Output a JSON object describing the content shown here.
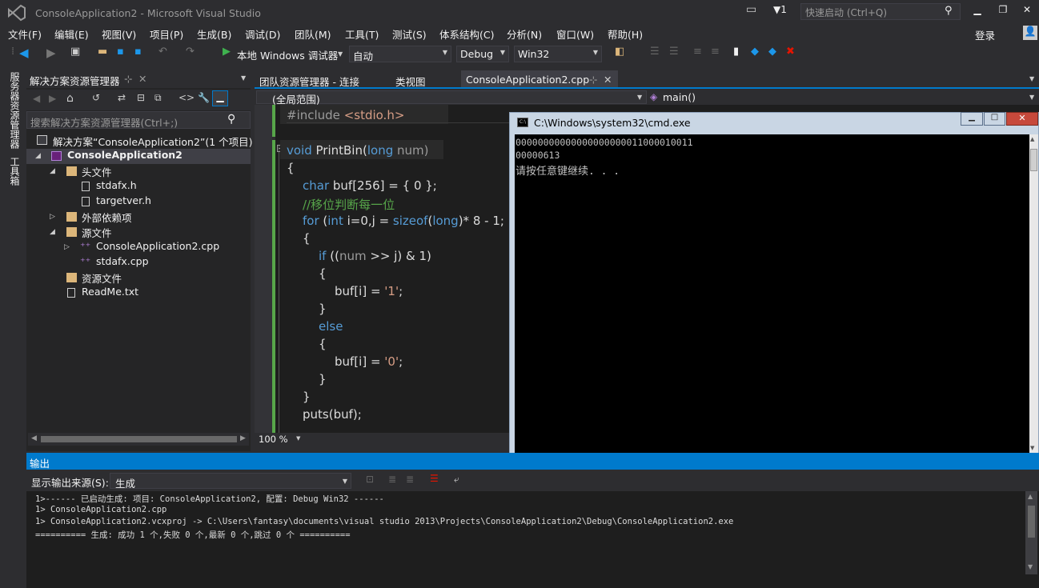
{
  "window": {
    "title": "ConsoleApplication2 - Microsoft Visual Studio",
    "quick_launch": "快速启动 (Ctrl+Q)",
    "notif_count": "1",
    "login": "登录"
  },
  "menu": [
    "文件(F)",
    "编辑(E)",
    "视图(V)",
    "项目(P)",
    "生成(B)",
    "调试(D)",
    "团队(M)",
    "工具(T)",
    "测试(S)",
    "体系结构(C)",
    "分析(N)",
    "窗口(W)",
    "帮助(H)"
  ],
  "toolbar": {
    "debugger": "本地 Windows 调试器",
    "auto": "自动",
    "config": "Debug",
    "platform": "Win32"
  },
  "side_tabs": {
    "server": "服务器资源管理器",
    "toolbox": "工具箱"
  },
  "solution_explorer": {
    "title": "解决方案资源管理器",
    "search_placeholder": "搜索解决方案资源管理器(Ctrl+;)",
    "items": [
      "解决方案“ConsoleApplication2”(1 个项目)",
      "ConsoleApplication2",
      "头文件",
      "stdafx.h",
      "targetver.h",
      "外部依赖项",
      "源文件",
      "ConsoleApplication2.cpp",
      "stdafx.cpp",
      "资源文件",
      "ReadMe.txt"
    ]
  },
  "tabs": {
    "team": "团队资源管理器 - 连接",
    "classview": "类视图",
    "active": "ConsoleApplication2.cpp"
  },
  "nav": {
    "scope": "(全局范围)",
    "member": "main()"
  },
  "code": {
    "l1a": "#include ",
    "l1b": "<stdio.h>",
    "l2a": "void ",
    "l2b": "PrintBin(",
    "l2c": "long ",
    "l2d": "num)",
    "l3": "{",
    "l4a": "char ",
    "l4b": "buf[256] = { 0 };",
    "l5": "//移位判断每一位",
    "l6a": "for ",
    "l6b": "(",
    "l6c": "int ",
    "l6d": "i=0,j = ",
    "l6e": "sizeof",
    "l6f": "(",
    "l6g": "long",
    "l6h": ")* 8 - 1;",
    "l7": "{",
    "l8a": "if ",
    "l8b": "((",
    "l8c": "num ",
    "l8d": ">> j) & 1)",
    "l9": "{",
    "l10a": "buf[i] = ",
    "l10b": "'1'",
    ";": ";",
    "l11": "}",
    "l12": "else",
    "l13": "{",
    "l14a": "buf[i] = ",
    "l14b": "'0'",
    "l15": "}",
    "l16": "}",
    "l17": "puts(buf);"
  },
  "zoom": "100 %",
  "cmd": {
    "title": "C:\\Windows\\system32\\cmd.exe",
    "lines": [
      "00000000000000000000011000010011",
      "00000613",
      "请按任意键继续. . ."
    ]
  },
  "output": {
    "title": "输出",
    "source_label": "显示输出来源(S):",
    "source_value": "生成",
    "lines": [
      "1>------ 已启动生成:  项目: ConsoleApplication2, 配置: Debug Win32 ------",
      "1>  ConsoleApplication2.cpp",
      "1>  ConsoleApplication2.vcxproj -> C:\\Users\\fantasy\\documents\\visual studio 2013\\Projects\\ConsoleApplication2\\Debug\\ConsoleApplication2.exe",
      "========== 生成:  成功 1 个,失败 0 个,最新 0 个,跳过 0 个 =========="
    ]
  }
}
